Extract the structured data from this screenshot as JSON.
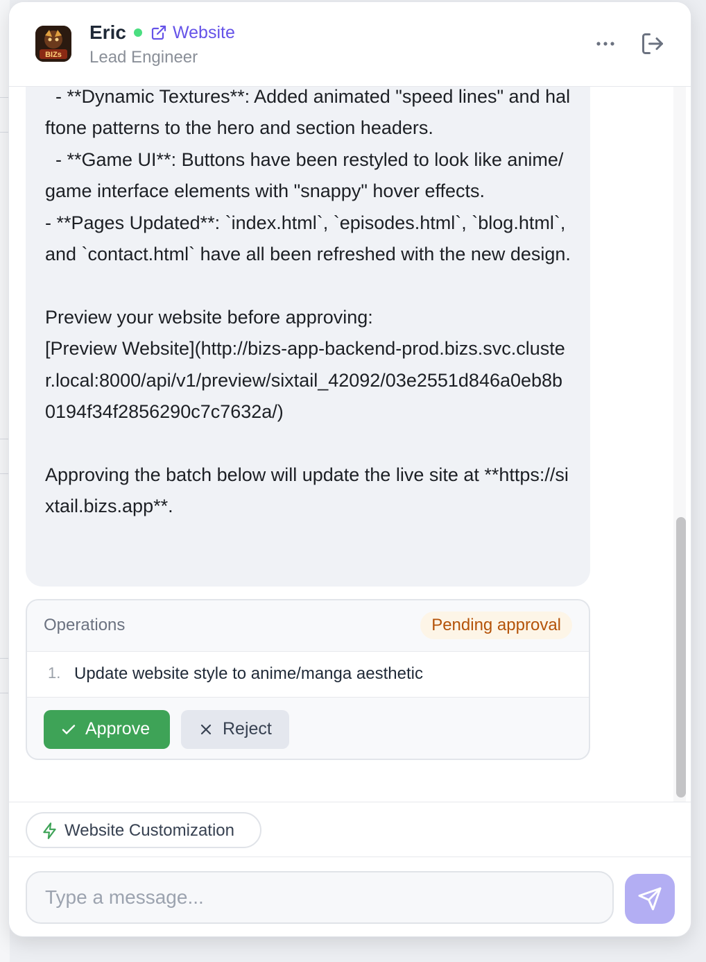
{
  "header": {
    "agent_name": "Eric",
    "website_link_label": "Website",
    "role": "Lead Engineer",
    "avatar_text": "BIZs",
    "status_color": "#4ade80",
    "icons": [
      "external-link-icon",
      "more-icon",
      "logout-icon"
    ]
  },
  "message": {
    "text": "  - **Dynamic Textures**: Added animated \"speed lines\" and halftone patterns to the hero and section headers.\n  - **Game UI**: Buttons have been restyled to look like anime/game interface elements with \"snappy\" hover effects.\n- **Pages Updated**: `index.html`, `episodes.html`, `blog.html`, and `contact.html` have all been refreshed with the new design.\n\nPreview your website before approving:\n[Preview Website](http://bizs-app-backend-prod.bizs.svc.cluster.local:8000/api/v1/preview/sixtail_42092/03e2551d846a0eb8b0194f34f2856290c7c7632a/)\n\nApproving the batch below will update the live site at **https://sixtail.bizs.app**."
  },
  "operations": {
    "title": "Operations",
    "status": "Pending approval",
    "items": [
      {
        "number": "1.",
        "text": "Update website style to anime/manga aesthetic"
      }
    ],
    "approve_label": "Approve",
    "reject_label": "Reject"
  },
  "chips": [
    {
      "label": "Website Customization",
      "icon": "bolt-icon"
    }
  ],
  "composer": {
    "placeholder": "Type a message...",
    "value": ""
  },
  "colors": {
    "accent": "#6553e8",
    "approve": "#3ea357",
    "pending_text": "#b45309",
    "send_button": "#b3aef3"
  }
}
